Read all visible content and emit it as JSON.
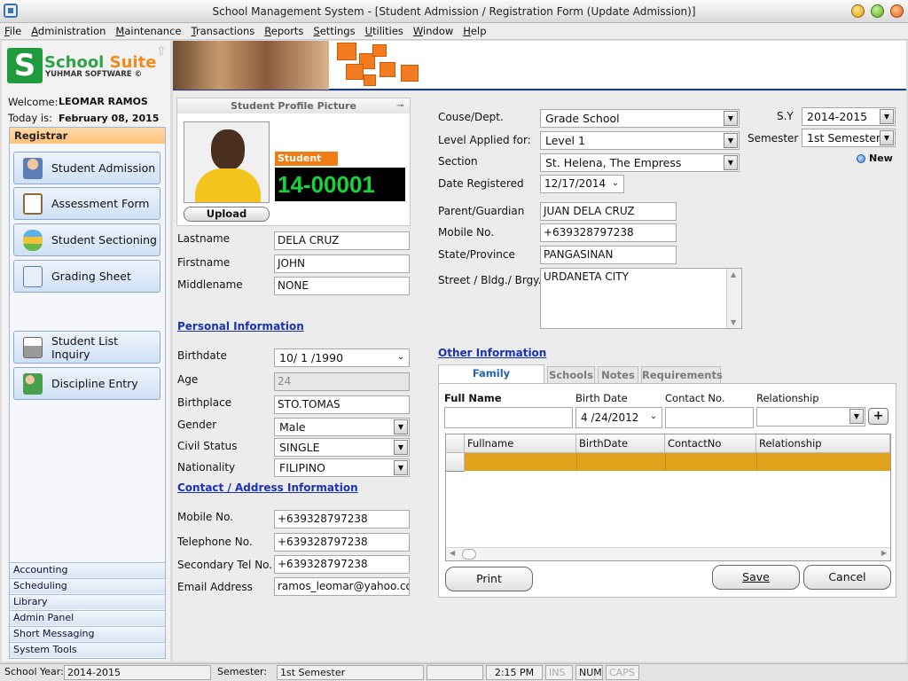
{
  "window": {
    "title": "School Management System - [Student Admission / Registration Form (Update Admission)]"
  },
  "menu": [
    "File",
    "Administration",
    "Maintenance",
    "Transactions",
    "Reports",
    "Settings",
    "Utilities",
    "Window",
    "Help"
  ],
  "logo": {
    "name_a": "School",
    "name_b": "Suite",
    "sub": "YUHMAR SOFTWARE ©"
  },
  "user": {
    "welcome_label": "Welcome:",
    "welcome_name": "LEOMAR RAMOS",
    "today_label": "Today is:",
    "today_value": "February 08, 2015"
  },
  "nav": {
    "header": "Registrar",
    "items": [
      {
        "label": "Student Admission",
        "icon": "user-icon"
      },
      {
        "label": "Assessment Form",
        "icon": "clipboard-icon"
      },
      {
        "label": "Student Sectioning",
        "icon": "stack-icon"
      },
      {
        "label": "Grading Sheet",
        "icon": "sheet-icon"
      },
      {
        "label": "Student List Inquiry",
        "icon": "printer-icon"
      },
      {
        "label": "Discipline Entry",
        "icon": "users-icon"
      }
    ],
    "groups": [
      "Accounting",
      "Scheduling",
      "Library",
      "Admin Panel",
      "Short Messaging",
      "System Tools"
    ]
  },
  "profile": {
    "header": "Student Profile Picture",
    "upload": "Upload",
    "student_no_label": "Student No.",
    "student_no": "14-00001"
  },
  "name": {
    "last_label": "Lastname",
    "last": "DELA CRUZ",
    "first_label": "Firstname",
    "first": "JOHN",
    "middle_label": "Middlename",
    "middle": "NONE"
  },
  "personal": {
    "section": "Personal Information",
    "birthdate_label": "Birthdate",
    "birthdate": "10/ 1 /1990",
    "age_label": "Age",
    "age": "24",
    "birthplace_label": "Birthplace",
    "birthplace": "STO.TOMAS",
    "gender_label": "Gender",
    "gender": "Male",
    "civil_label": "Civil Status",
    "civil": "SINGLE",
    "nationality_label": "Nationality",
    "nationality": "FILIPINO"
  },
  "contact": {
    "section": "Contact / Address Information",
    "mobile_label": "Mobile No.",
    "mobile": "+639328797238",
    "tel_label": "Telephone No.",
    "tel": "+639328797238",
    "sec_label": "Secondary Tel No.",
    "sec": "+639328797238",
    "email_label": "Email Address",
    "email": "ramos_leomar@yahoo.com"
  },
  "enroll": {
    "course_label": "Couse/Dept.",
    "course": "Grade School",
    "level_label": "Level Applied for:",
    "level": "Level 1",
    "section_label": "Section",
    "section": "St. Helena, The Empress",
    "date_label": "Date Registered",
    "date": "12/17/2014",
    "sy_label": "S.Y",
    "sy": "2014-2015",
    "sem_label": "Semester",
    "sem": "1st Semester",
    "new_label": "New"
  },
  "guardian": {
    "parent_label": "Parent/Guardian",
    "parent": "JUAN DELA CRUZ",
    "mobile_label": "Mobile No.",
    "mobile": "+639328797238",
    "state_label": "State/Province",
    "state": "PANGASINAN",
    "street_label": "Street / Bldg./ Brgy.",
    "street": "URDANETA CITY"
  },
  "other": {
    "section": "Other Information",
    "tabs": [
      "Family Background",
      "Schools",
      "Notes",
      "Requirements"
    ],
    "fullname_label": "Full Name",
    "fullname": "",
    "birth_label": "Birth Date",
    "birth": "4 /24/2012",
    "contact_label": "Contact No.",
    "contact": "",
    "rel_label": "Relationship",
    "rel": "",
    "add": "+",
    "grid_headers": [
      "Fullname",
      "BirthDate",
      "ContactNo",
      "Relationship"
    ]
  },
  "buttons": {
    "print": "Print",
    "save": "Save",
    "cancel": "Cancel"
  },
  "status": {
    "sy_label": "School Year:",
    "sy": "2014-2015",
    "sem_label": "Semester:",
    "sem": "1st Semester",
    "time": "2:15 PM",
    "ins": "INS",
    "num": "NUM",
    "caps": "CAPS"
  },
  "colors": {
    "accent": "#f07d14",
    "link": "#1a31b8",
    "student_no": "#13d63a",
    "grid_row": "#e0a21a"
  }
}
